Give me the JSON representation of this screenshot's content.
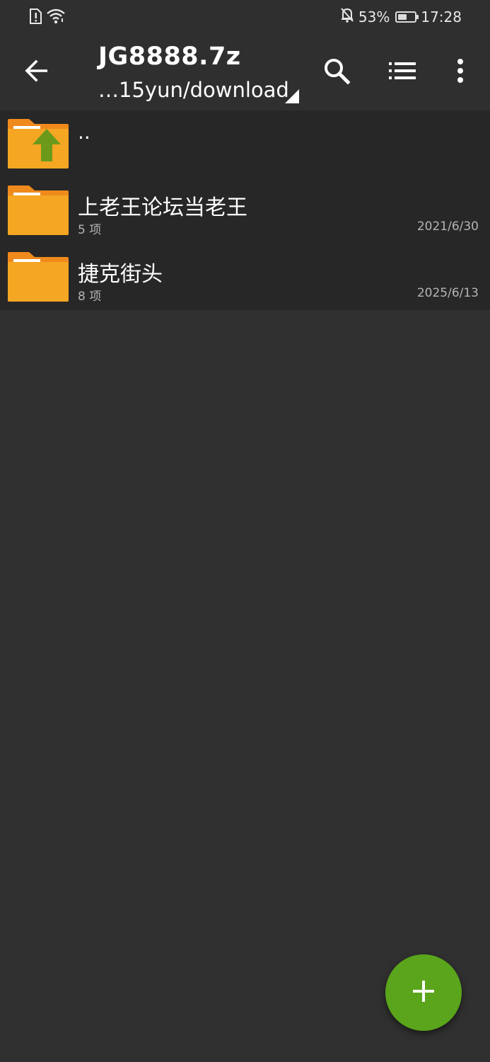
{
  "status_bar": {
    "battery_percent": "53%",
    "battery_level": 0.53,
    "time": "17:28",
    "icons": [
      "sim-alert-icon",
      "wifi-icon",
      "bell-off-icon",
      "battery-icon"
    ]
  },
  "toolbar": {
    "title": "JG8888.7z",
    "path": "…15yun/download",
    "icons": [
      "back-arrow-icon",
      "search-icon",
      "list-view-icon",
      "more-vert-icon"
    ]
  },
  "files": {
    "parent": {
      "name": ".."
    },
    "items": [
      {
        "name": "上老王论坛当老王",
        "count": "5 项",
        "date": "2021/6/30"
      },
      {
        "name": "捷克街头",
        "count": "8 项",
        "date": "2025/6/13"
      }
    ]
  },
  "fab": {
    "icon": "plus-icon",
    "label": "+"
  },
  "colors": {
    "background": "#303030",
    "toolbar": "#2f2f2f",
    "list_background": "#272727",
    "folder_orange": "#f5a623",
    "folder_tab": "#f08a1c",
    "up_arrow_green": "#6b9a1b",
    "fab_green": "#5aa51b"
  }
}
